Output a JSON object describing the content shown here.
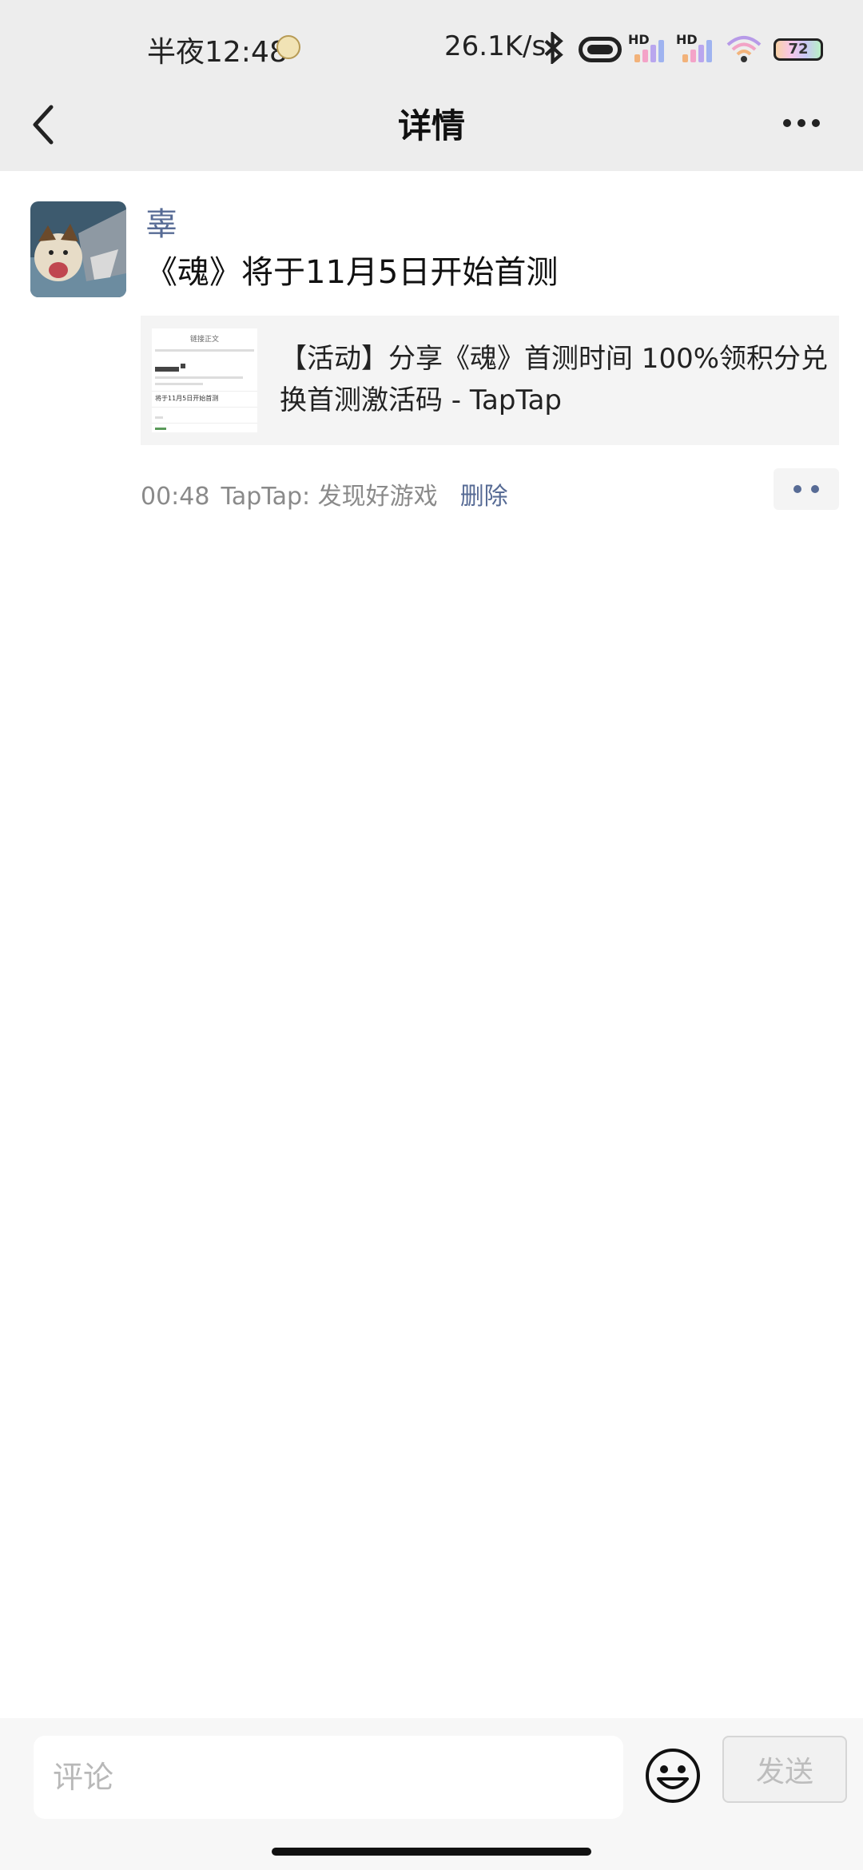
{
  "status_bar": {
    "time": "半夜12:48",
    "net_speed": "26.1K/s",
    "signal_label_1": "HD",
    "signal_label_2": "HD",
    "battery": "72"
  },
  "nav": {
    "title": "详情",
    "back_icon": "chevron-left-icon",
    "more_icon": "more-horizontal-icon"
  },
  "post": {
    "author": "辜",
    "text": "《魂》将于11月5日开始首测",
    "link_card": {
      "title": "【活动】分享《魂》首测时间 100%领积分兑换首测激活码 - TapTap",
      "thumb_heading": "链接正文",
      "thumb_line": "将于11月5日开始首测"
    },
    "time": "00:48",
    "source": "TapTap: 发现好游戏",
    "delete_label": "删除"
  },
  "comment_bar": {
    "placeholder": "评论",
    "send_label": "发送",
    "emoji_icon": "smiley-icon"
  },
  "colors": {
    "link_blue": "#576b95",
    "header_bg": "#ededed",
    "card_bg": "#f4f4f4"
  }
}
